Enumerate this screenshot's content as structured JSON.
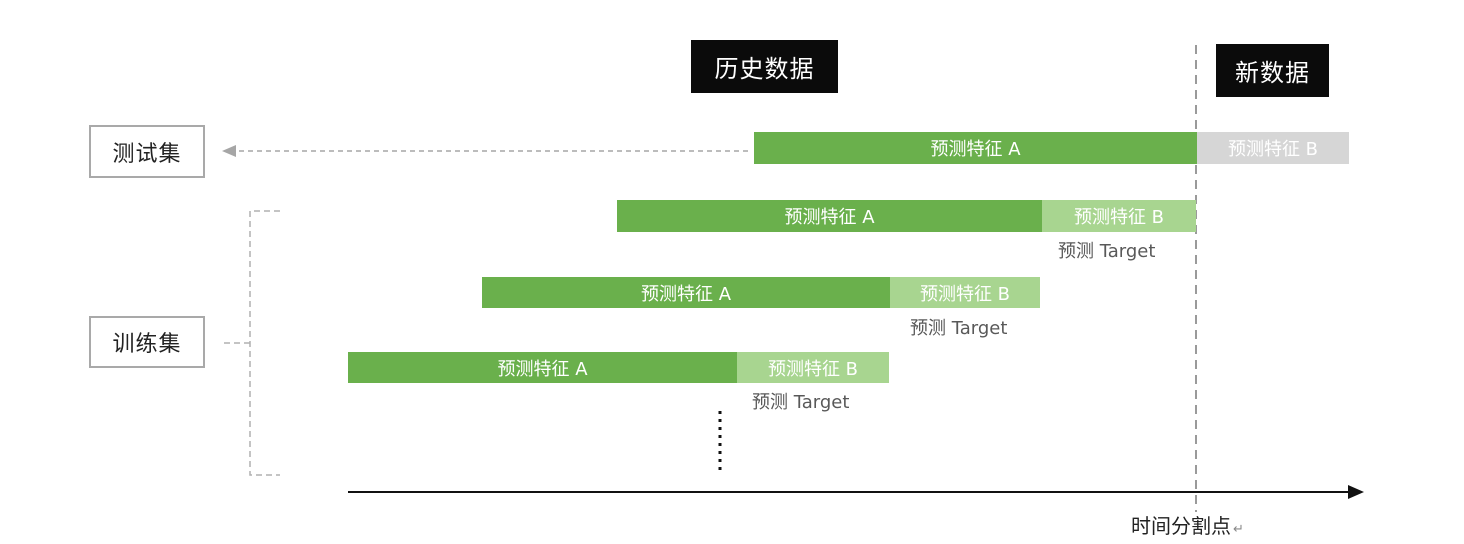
{
  "headers": {
    "historical": "历史数据",
    "new_data": "新数据"
  },
  "sets": {
    "test": "测试集",
    "train": "训练集"
  },
  "rows": [
    {
      "feature_a": "预测特征 A",
      "feature_b": "预测特征 B"
    },
    {
      "feature_a": "预测特征 A",
      "feature_b": "预测特征 B",
      "target": "预测 Target"
    },
    {
      "feature_a": "预测特征 A",
      "feature_b": "预测特征 B",
      "target": "预测 Target"
    },
    {
      "feature_a": "预测特征 A",
      "feature_b": "预测特征 B",
      "target": "预测 Target"
    }
  ],
  "axis": {
    "split_label": "时间分割点",
    "return_mark": "↵"
  },
  "colors": {
    "feature_a": "#6ab04c",
    "feature_b": "#a8d590",
    "future": "#d6d6d6",
    "header_bg": "#0b0b0b"
  }
}
